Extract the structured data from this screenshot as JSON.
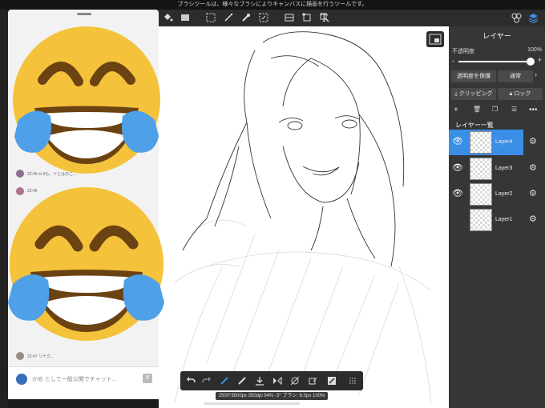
{
  "notice": "ブラシツールは、様々なブラシによりキャンバスに描画を行うツールです。",
  "layer_panel": {
    "title": "レイヤー",
    "opacity_label": "不透明度",
    "opacity_value": "100%",
    "opacity_level": 1.0,
    "protect_alpha_label": "透明度を保護",
    "blend_mode_label": "通常",
    "clipping_label": "クリッピング",
    "lock_label": "ロック",
    "list_header": "レイヤー一覧",
    "layers": [
      {
        "name": "Layer4",
        "selected": true,
        "visible": true
      },
      {
        "name": "Layer3",
        "selected": false,
        "visible": true
      },
      {
        "name": "Layer2",
        "selected": false,
        "visible": true
      },
      {
        "name": "Layer1",
        "selected": false,
        "visible": false
      }
    ]
  },
  "chat": {
    "messages": [
      {
        "time": "22:46",
        "text": "m 9も、ドとはのこ..."
      },
      {
        "time": "22:46",
        "text": ""
      },
      {
        "time": "22:47",
        "text": "リナク..."
      }
    ],
    "input_placeholder": "かめ として一般公開でチャット..."
  },
  "status_bar": "2500*3500px 350dpi 94% -3° ブラシ: 6.0px 100%",
  "colors": {
    "accent": "#3a8ee6",
    "panel": "#363636",
    "toolbar": "#2c2c2c"
  },
  "icons": [
    "menu-icon",
    "fill-bucket-icon",
    "gradient-icon",
    "select-icon",
    "magic-wand-icon",
    "eyedropper-icon",
    "lasso-icon",
    "ruler-icon",
    "transform-icon",
    "text-icon",
    "material-icon",
    "layers-icon",
    "undo-icon",
    "redo-icon",
    "pen-icon",
    "eraser-icon",
    "download-icon",
    "flip-icon",
    "rotate-icon",
    "fill-icon",
    "snap-icon",
    "grid-icon"
  ]
}
